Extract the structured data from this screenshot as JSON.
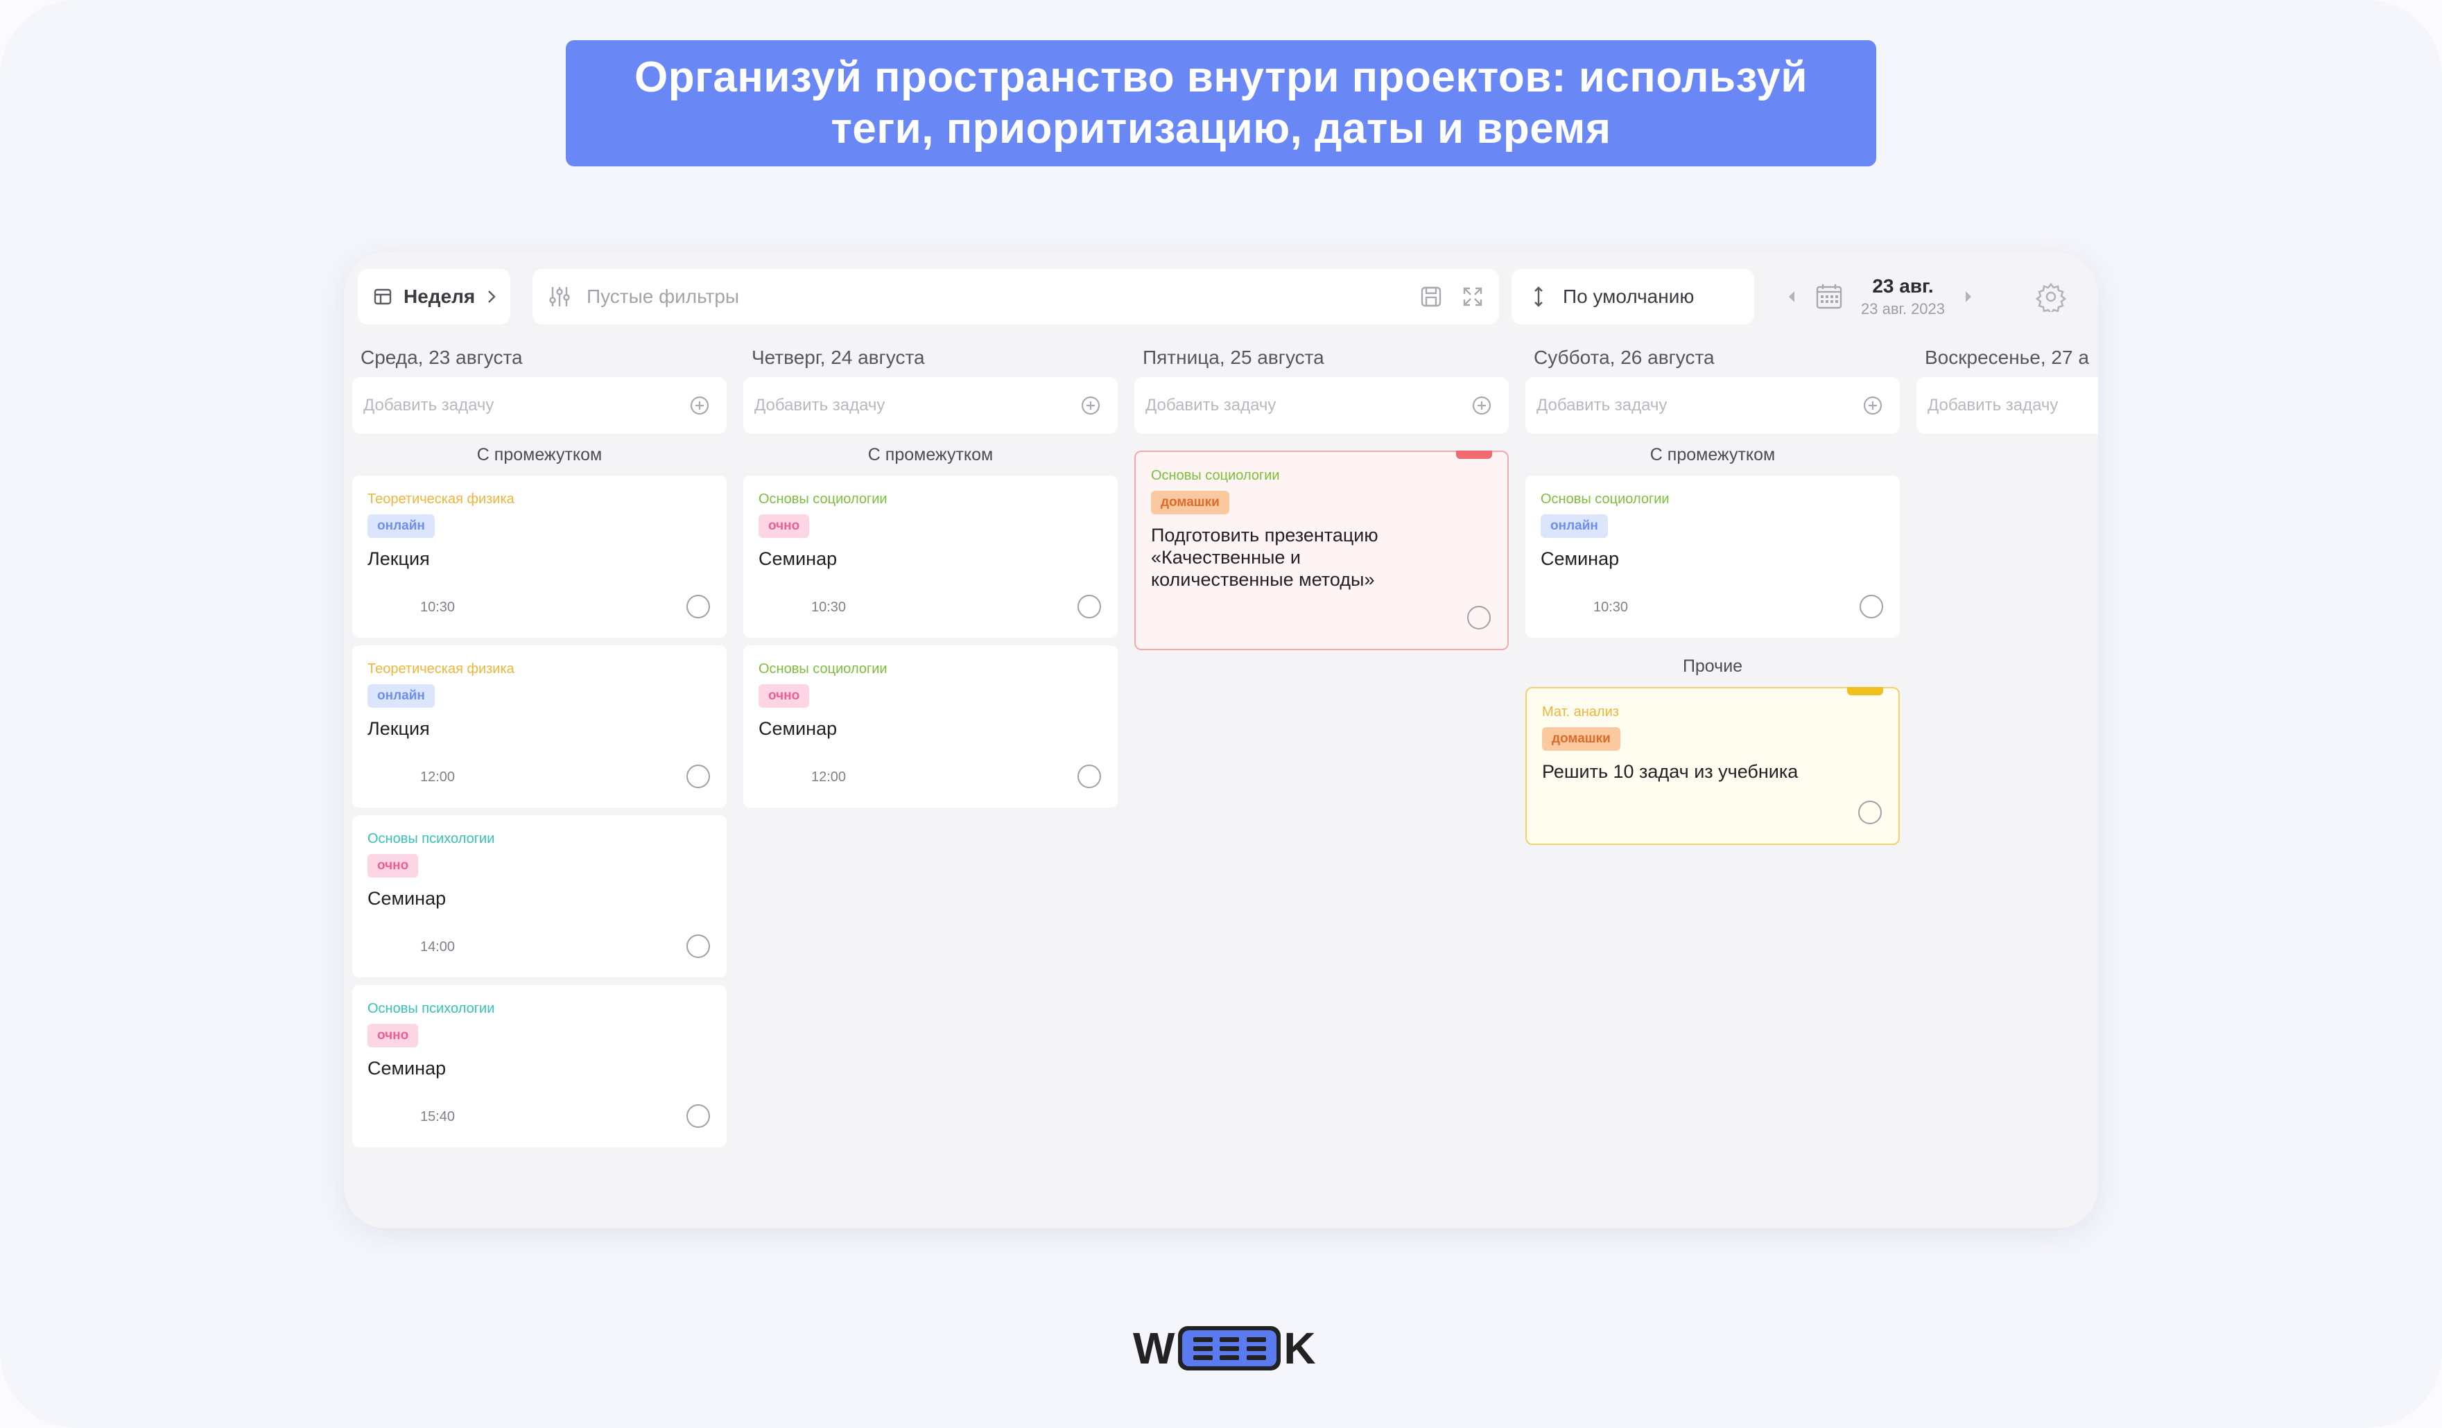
{
  "banner": {
    "line1": "Организуй пространство внутри проектов: используй",
    "line2": "теги, приоритизацию, даты и время"
  },
  "toolbar": {
    "view_label": "Неделя",
    "filter_placeholder": "Пустые фильтры",
    "sort_label": "По умолчанию",
    "date_main": "23 авг.",
    "date_sub": "23 авг. 2023"
  },
  "add_task_placeholder": "Добавить задачу",
  "colors": {
    "accent": "#6987f5",
    "tag_online": "#6f8ff0",
    "tag_ochno": "#ee5f93",
    "tag_homework": "#de6b2a",
    "priority_high": "#f06a6f",
    "priority_medium": "#f0c020"
  },
  "columns": [
    {
      "header": "Среда, 23 августа",
      "groups": [
        {
          "label": "С промежутком",
          "cards": [
            {
              "project": "Теоретическая физика",
              "tag": "онлайн",
              "title": "Лекция",
              "time": "10:30"
            },
            {
              "project": "Теоретическая физика",
              "tag": "онлайн",
              "title": "Лекция",
              "time": "12:00"
            },
            {
              "project": "Основы психологии",
              "tag": "очно",
              "title": "Семинар",
              "time": "14:00"
            },
            {
              "project": "Основы психологии",
              "tag": "очно",
              "title": "Семинар",
              "time": "15:40"
            }
          ]
        }
      ]
    },
    {
      "header": "Четверг, 24 августа",
      "groups": [
        {
          "label": "С промежутком",
          "cards": [
            {
              "project": "Основы социологии",
              "tag": "очно",
              "title": "Семинар",
              "time": "10:30"
            },
            {
              "project": "Основы социологии",
              "tag": "очно",
              "title": "Семинар",
              "time": "12:00"
            }
          ]
        }
      ]
    },
    {
      "header": "Пятница, 25 августа",
      "groups": [
        {
          "label": "",
          "cards": [
            {
              "project": "Основы социологии",
              "tag": "домашки",
              "title": "Подготовить презентацию «Качественные и количественные методы»",
              "priority": "high"
            }
          ]
        }
      ]
    },
    {
      "header": "Суббота, 26 августа",
      "groups": [
        {
          "label": "С промежутком",
          "cards": [
            {
              "project": "Основы социологии",
              "tag": "онлайн",
              "title": "Семинар",
              "time": "10:30"
            }
          ]
        },
        {
          "label": "Прочие",
          "cards": [
            {
              "project": "Мат. анализ",
              "tag": "домашки",
              "title": "Решить 10 задач из учебника",
              "priority": "medium"
            }
          ]
        }
      ]
    },
    {
      "header": "Воскресенье, 27 а",
      "groups": []
    }
  ],
  "logo": {
    "left": "W",
    "right": "K"
  }
}
